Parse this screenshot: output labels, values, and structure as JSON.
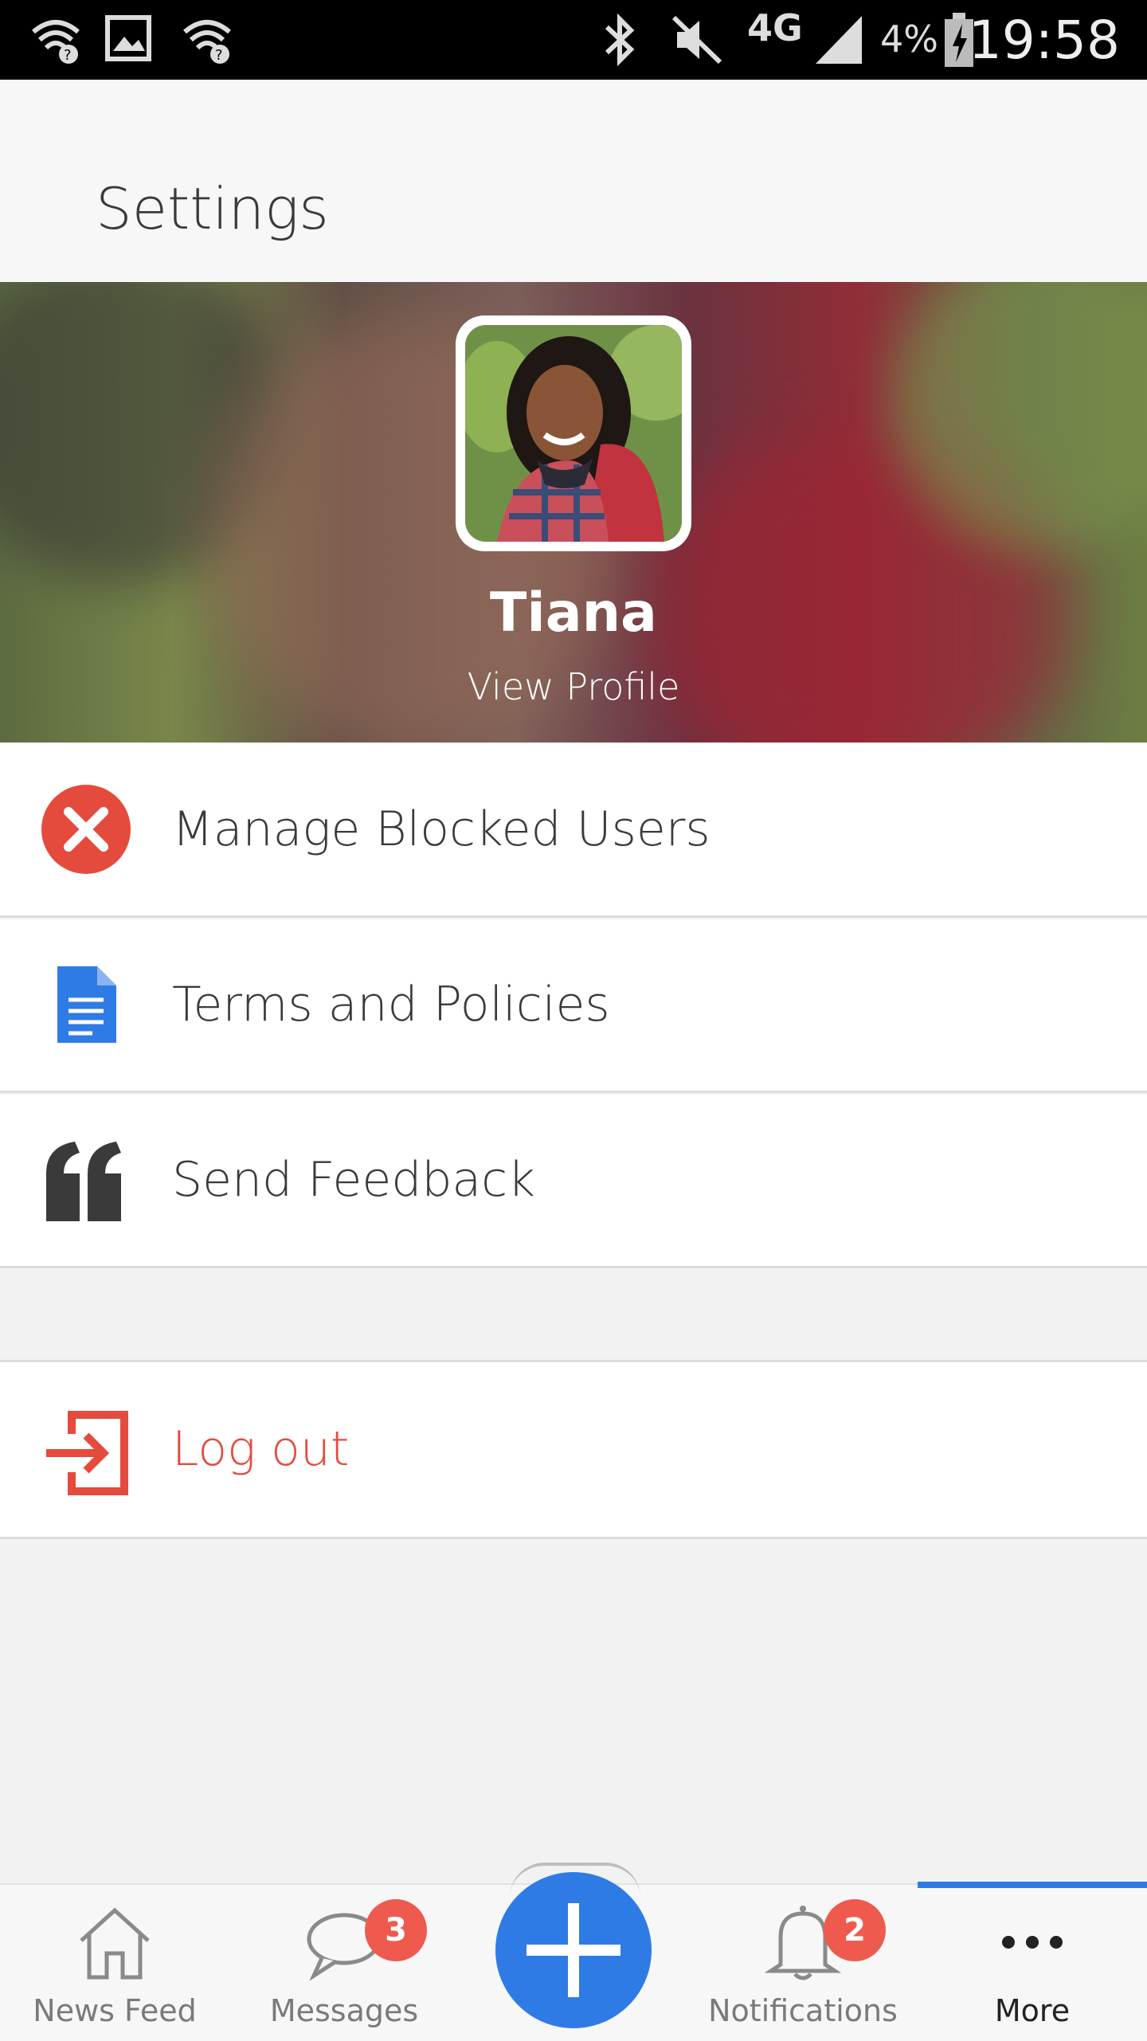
{
  "status_bar": {
    "battery_percent": "4%",
    "time": "19:58",
    "network": "4G",
    "icons": [
      "wifi-question-icon",
      "image-icon",
      "wifi-question-icon",
      "bluetooth-icon",
      "mute-icon",
      "4g-lte-icon",
      "signal-icon",
      "battery-charging-icon"
    ]
  },
  "header": {
    "title": "Settings"
  },
  "profile": {
    "name": "Tiana",
    "view_profile": "View Profile"
  },
  "menu": {
    "blocked_users": "Manage Blocked Users",
    "terms": "Terms and Policies",
    "feedback": "Send Feedback",
    "logout": "Log out"
  },
  "nav": {
    "news_feed": "News Feed",
    "messages": "Messages",
    "messages_badge": "3",
    "notifications": "Notifications",
    "notifications_badge": "2",
    "more": "More"
  },
  "colors": {
    "accent": "#2f7be6",
    "danger": "#e44b3d",
    "badge": "#ef5a4e"
  }
}
